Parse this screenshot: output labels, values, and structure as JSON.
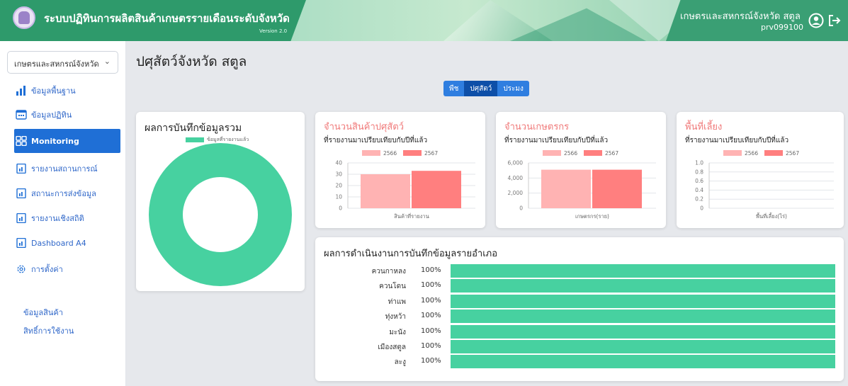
{
  "header": {
    "app_title": "ระบบปฏิทินการผลิตสินค้าเกษตรรายเดือนระดับจังหวัด",
    "version": "Version 2.0",
    "user_name": "เกษตรและสหกรณ์จังหวัด สตูล",
    "user_code": "prv099100",
    "colors": {
      "brand": "#2e9a6b",
      "accent": "#47d1a0"
    }
  },
  "sidebar": {
    "org_select": "เกษตรและสหกรณ์จังหวัด",
    "items": [
      {
        "label": "ข้อมูลพื้นฐาน",
        "icon": "bar-chart-icon"
      },
      {
        "label": "ข้อมูลปฏิทิน",
        "icon": "calendar-icon"
      },
      {
        "label": "Monitoring",
        "icon": "grid-icon",
        "active": true
      },
      {
        "label": "รายงานสถานการณ์",
        "icon": "report-icon"
      },
      {
        "label": "สถานะการส่งข้อมูล",
        "icon": "report-icon"
      },
      {
        "label": "รายงานเชิงสถิติ",
        "icon": "report-icon"
      },
      {
        "label": "Dashboard A4",
        "icon": "report-icon"
      },
      {
        "label": "การตั้งค่า",
        "icon": "gear-icon"
      }
    ],
    "sub_items": [
      "ข้อมูลสินค้า",
      "สิทธิ์การใช้งาน"
    ]
  },
  "main": {
    "page_title": "ปศุสัตว์จังหวัด สตูล",
    "tabs": [
      {
        "label": "พืช",
        "active": false
      },
      {
        "label": "ปศุสัตว์",
        "active": true
      },
      {
        "label": "ประมง",
        "active": false
      }
    ]
  },
  "chart_data": [
    {
      "type": "pie",
      "title": "ผลการบันทึกข้อมูลรวม",
      "legend": [
        "ข้อมูลที่รายงานแล้ว"
      ],
      "values": [
        100
      ],
      "color": "#47d1a0"
    },
    {
      "type": "bar",
      "title": "จำนวนสินค้าปศุสัตว์",
      "subtitle": "ที่รายงานมาเปรียบเทียบกับปีที่แล้ว",
      "xlabel": "สินค้าที่รายงาน",
      "series": [
        {
          "name": "2566",
          "values": [
            30
          ]
        },
        {
          "name": "2567",
          "values": [
            33
          ]
        }
      ],
      "ylim": [
        0,
        40
      ],
      "ticks": [
        "0",
        "10",
        "20",
        "30",
        "40"
      ]
    },
    {
      "type": "bar",
      "title": "จำนวนเกษตรกร",
      "subtitle": "ที่รายงานมาเปรียบเทียบกับปีที่แล้ว",
      "xlabel": "เกษตรกร(ราย)",
      "series": [
        {
          "name": "2566",
          "values": [
            5100
          ]
        },
        {
          "name": "2567",
          "values": [
            5100
          ]
        }
      ],
      "ylim": [
        0,
        6000
      ],
      "ticks": [
        "0",
        "2,000",
        "4,000",
        "6,000"
      ]
    },
    {
      "type": "bar",
      "title": "พื้นที่เลี้ยง",
      "subtitle": "ที่รายงานมาเปรียบเทียบกับปีที่แล้ว",
      "xlabel": "พื้นที่เลี้ยง(ไร่)",
      "series": [
        {
          "name": "2566",
          "values": [
            0
          ]
        },
        {
          "name": "2567",
          "values": [
            0
          ]
        }
      ],
      "ylim": [
        0,
        1.0
      ],
      "ticks": [
        "0",
        "0.2",
        "0.4",
        "0.6",
        "0.8",
        "1.0"
      ]
    },
    {
      "type": "bar",
      "title": "ผลการดำเนินงานการบันทึกข้อมูลรายอำเภอ",
      "categories": [
        "ควนกาหลง",
        "ควนโดน",
        "ท่าแพ",
        "ทุ่งหว้า",
        "มะนัง",
        "เมืองสตูล",
        "ละงู"
      ],
      "values": [
        100,
        100,
        100,
        100,
        100,
        100,
        100
      ],
      "labels": [
        "100%",
        "100%",
        "100%",
        "100%",
        "100%",
        "100%",
        "100%"
      ]
    }
  ],
  "series_colors": {
    "2566": "#ffb3b3",
    "2567": "#ff7f7f"
  }
}
